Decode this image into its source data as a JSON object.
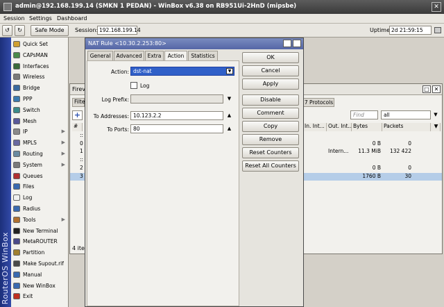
{
  "titlebar": {
    "title": "admin@192.168.199.14 (SMKN 1 PEDAN) - WinBox v6.38 on RB951Ui-2HnD (mipsbe)",
    "close": "✕"
  },
  "menubar": {
    "items": [
      "Session",
      "Settings",
      "Dashboard"
    ]
  },
  "toolbar": {
    "undo": "↺",
    "redo": "↻",
    "safe_mode": "Safe Mode",
    "session_label": "Session:",
    "session_value": "192.168.199.14",
    "uptime_label": "Uptime:",
    "uptime_value": "2d 21:59:15"
  },
  "sidebar": {
    "brand": "RouterOS WinBox",
    "items": [
      {
        "label": "Quick Set",
        "icon": "quickset-icon",
        "color": "#d0a030"
      },
      {
        "label": "CAPsMAN",
        "icon": "capsman-icon",
        "color": "#4a8a4a"
      },
      {
        "label": "Interfaces",
        "icon": "interfaces-icon",
        "color": "#3a6a3a"
      },
      {
        "label": "Wireless",
        "icon": "wireless-icon",
        "color": "#7a7a7a"
      },
      {
        "label": "Bridge",
        "icon": "bridge-icon",
        "color": "#3a6aa0"
      },
      {
        "label": "PPP",
        "icon": "ppp-icon",
        "color": "#3a7ab0"
      },
      {
        "label": "Switch",
        "icon": "switch-icon",
        "color": "#3a8a8a"
      },
      {
        "label": "Mesh",
        "icon": "mesh-icon",
        "color": "#5a5a9a"
      },
      {
        "label": "IP",
        "icon": "ip-icon",
        "color": "#8a8a8a",
        "arrow": "▶"
      },
      {
        "label": "MPLS",
        "icon": "mpls-icon",
        "color": "#6a6aa0",
        "arrow": "▶"
      },
      {
        "label": "Routing",
        "icon": "routing-icon",
        "color": "#6a8aa0",
        "arrow": "▶"
      },
      {
        "label": "System",
        "icon": "system-icon",
        "color": "#7a7a7a",
        "arrow": "▶"
      },
      {
        "label": "Queues",
        "icon": "queues-icon",
        "color": "#b03030"
      },
      {
        "label": "Files",
        "icon": "files-icon",
        "color": "#3a6ab0"
      },
      {
        "label": "Log",
        "icon": "log-icon",
        "color": "#f0f0f0"
      },
      {
        "label": "Radius",
        "icon": "radius-icon",
        "color": "#3a6ab0"
      },
      {
        "label": "Tools",
        "icon": "tools-icon",
        "color": "#b07030",
        "arrow": "▶"
      },
      {
        "label": "New Terminal",
        "icon": "terminal-icon",
        "color": "#222222"
      },
      {
        "label": "MetaROUTER",
        "icon": "metarouter-icon",
        "color": "#4a4a8a"
      },
      {
        "label": "Partition",
        "icon": "partition-icon",
        "color": "#a08030"
      },
      {
        "label": "Make Supout.rif",
        "icon": "supout-icon",
        "color": "#4a4a4a"
      },
      {
        "label": "Manual",
        "icon": "manual-icon",
        "color": "#3a6ab0"
      },
      {
        "label": "New WinBox",
        "icon": "winbox-icon",
        "color": "#3a6ab0"
      },
      {
        "label": "Exit",
        "icon": "exit-icon",
        "color": "#c03020"
      }
    ]
  },
  "firewall": {
    "title_partial": "Firev",
    "tab_partial": "Filte",
    "tab_protocols": "7 Protocols",
    "find_placeholder": "Find",
    "filter_value": "all",
    "status": "4 ite",
    "columns": [
      "#",
      "In. Int...",
      "Out. Int...",
      "Bytes",
      "Packets"
    ],
    "rows": [
      {
        "num": "::",
        "in": "",
        "out": "",
        "bytes": "",
        "packets": ""
      },
      {
        "num": "0",
        "in": "",
        "out": "",
        "bytes": "0 B",
        "packets": "0"
      },
      {
        "num": "1",
        "in": "",
        "out": "Intern...",
        "bytes": "11.3 MiB",
        "packets": "132 422"
      },
      {
        "num": "::",
        "in": "",
        "out": "",
        "bytes": "",
        "packets": ""
      },
      {
        "num": "2",
        "in": "",
        "out": "",
        "bytes": "0 B",
        "packets": "0"
      },
      {
        "num": "3",
        "in": "",
        "out": "",
        "bytes": "1760 B",
        "packets": "30",
        "selected": true
      }
    ]
  },
  "nat": {
    "title": "NAT Rule <10.30.2.253:80>",
    "tabs": [
      "General",
      "Advanced",
      "Extra",
      "Action",
      "Statistics"
    ],
    "active_tab": "Action",
    "action_label": "Action:",
    "action_value": "dst-nat",
    "log_label": "Log",
    "log_checked": false,
    "log_prefix_label": "Log Prefix:",
    "log_prefix_value": "",
    "to_addresses_label": "To Addresses:",
    "to_addresses_value": "10.123.2.2",
    "to_ports_label": "To Ports:",
    "to_ports_value": "80",
    "buttons": [
      "OK",
      "Cancel",
      "Apply",
      "Disable",
      "Comment",
      "Copy",
      "Remove",
      "Reset Counters",
      "Reset All Counters"
    ]
  }
}
